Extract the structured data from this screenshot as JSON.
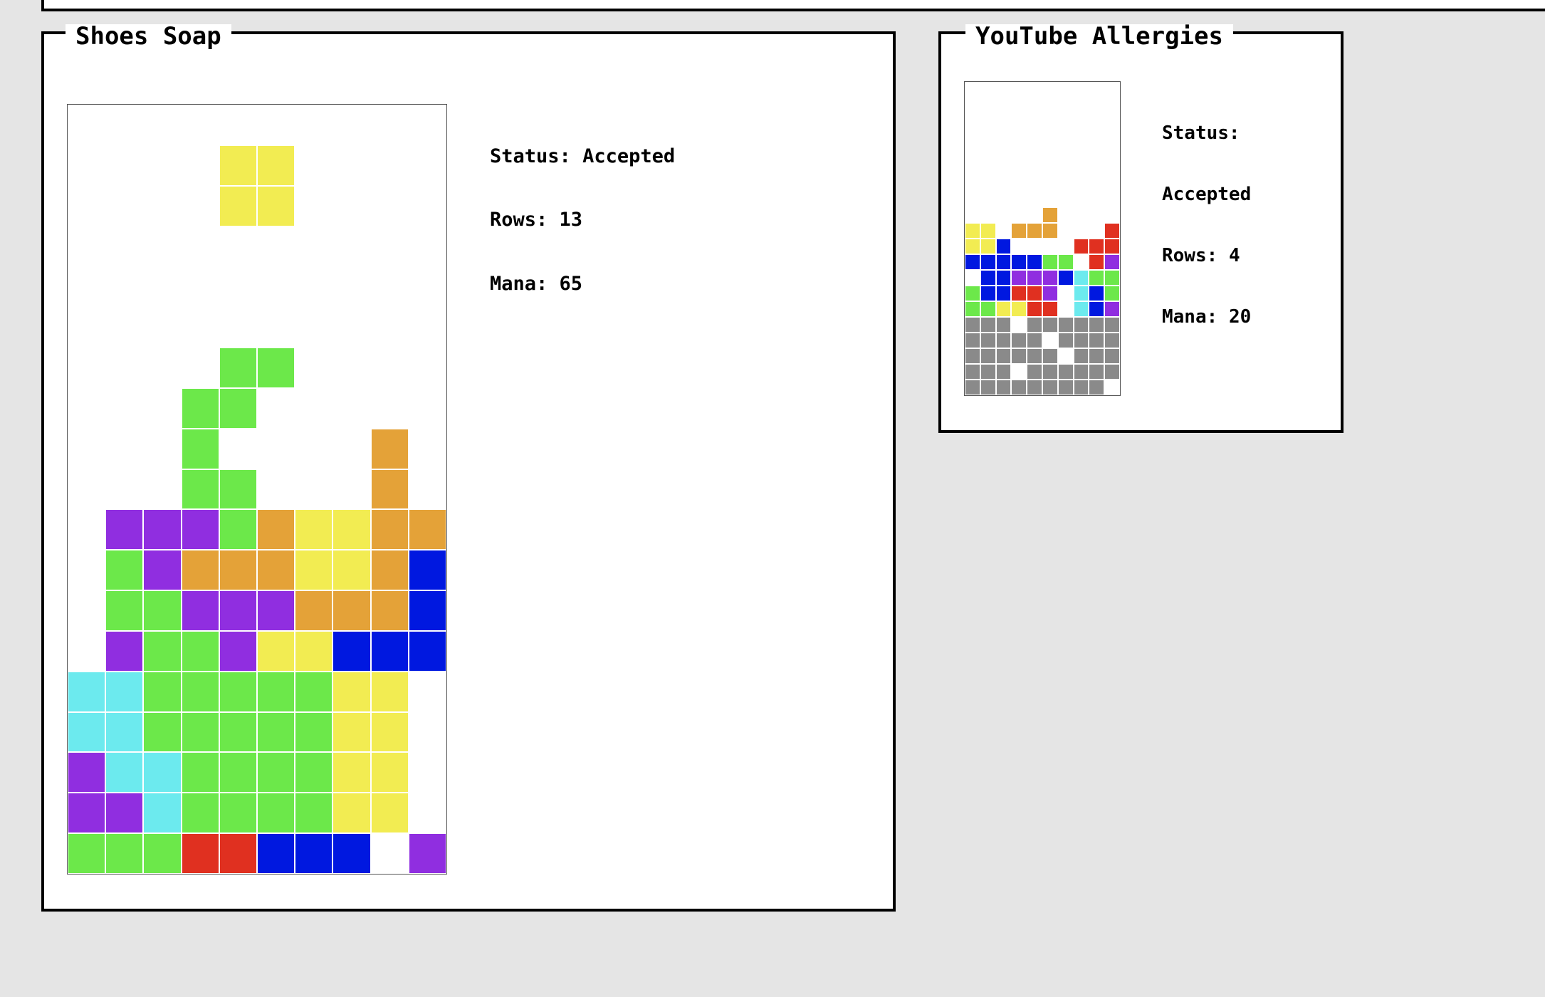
{
  "colors": {
    "Y": "#f2ec52",
    "G": "#6ce84a",
    "P": "#902ee0",
    "O": "#e4a238",
    "B": "#0018e0",
    "C": "#6ceaee",
    "R": "#e03020",
    "X": "#8a8a8a"
  },
  "panels": [
    {
      "title": "Shoes Soap",
      "status_label": "Status:",
      "status_value": "Accepted",
      "rows_label": "Rows:",
      "rows_value": "13",
      "mana_label": "Mana:",
      "mana_value": "65",
      "grid": [
        "..........",
        "....YY....",
        "....YY....",
        "..........",
        "..........",
        "..........",
        "....GG....",
        "...GG.....",
        "...G....O.",
        "...GG...O.",
        ".PPPGOYYOO",
        ".GPOOOYYOB",
        ".GGPPPOOOB",
        ".PGGPYYBBB",
        "CCGGGGGYY.",
        "CCGGGGGYY.",
        "PCCGGGGYY.",
        "PPCGGGGYY.",
        "GGGRRBBB.P"
      ]
    },
    {
      "title": "YouTube Allergies",
      "status_label": "Status:",
      "status_value": "Accepted",
      "rows_label": "Rows:",
      "rows_value": "4",
      "mana_label": "Mana:",
      "mana_value": "20",
      "grid": [
        "..........",
        "..........",
        "..........",
        "..........",
        "..........",
        "..........",
        "..........",
        "..........",
        ".....O....",
        "YY.OOO...R",
        "YYB....RRR",
        "BBBBBGG.RP",
        ".BBPPPBCGG",
        "GBBRRP.CBG",
        "GGYYRR.CBP",
        "XXX.XXXXXX",
        "XXXXX.XXXX",
        "XXXXXX.XXX",
        "XXX.XXXXXX",
        "XXXXXXXXX."
      ]
    }
  ]
}
